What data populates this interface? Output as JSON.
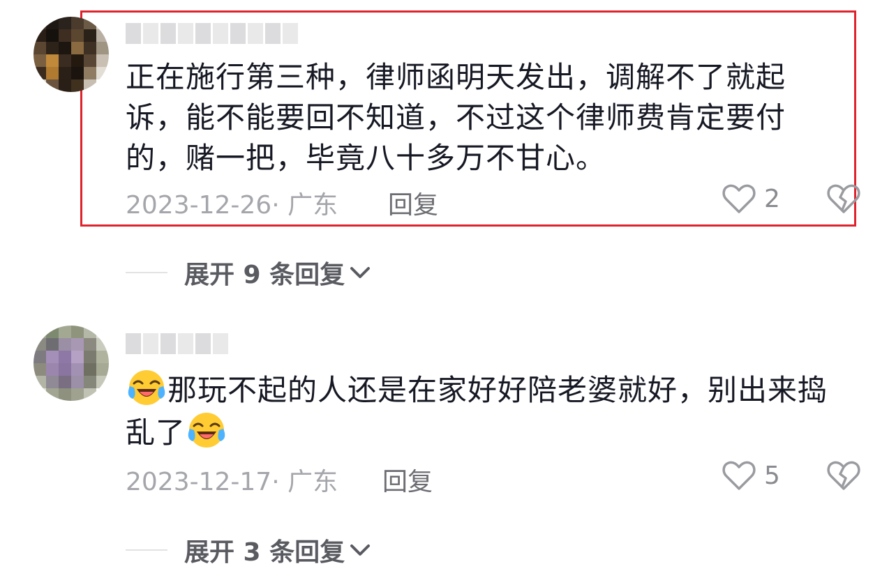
{
  "comments": [
    {
      "text": "正在施行第三种，律师函明天发出，调解不了就起诉，能不能要回不知道，不过这个律师费肯定要付的，赌一把，毕竟八十多万不甘心。",
      "date_location": "2023-12-26· 广东",
      "reply_label": "回复",
      "like_count": "2",
      "expand_label": "展开 9 条回复"
    },
    {
      "text_part1": "那玩不起的人还是在家好好陪老婆就好，别出来捣乱了",
      "date_location": "2023-12-17· 广东",
      "reply_label": "回复",
      "like_count": "5",
      "expand_label": "展开 3 条回复"
    }
  ],
  "icons": {
    "like": "heart-outline-icon",
    "dislike": "broken-heart-icon",
    "expand": "chevron-down-icon",
    "emoji": "laughing-crying-emoji"
  },
  "colors": {
    "highlight": "#e0222c",
    "text_primary": "#161823",
    "text_secondary": "#a5a6ab"
  }
}
